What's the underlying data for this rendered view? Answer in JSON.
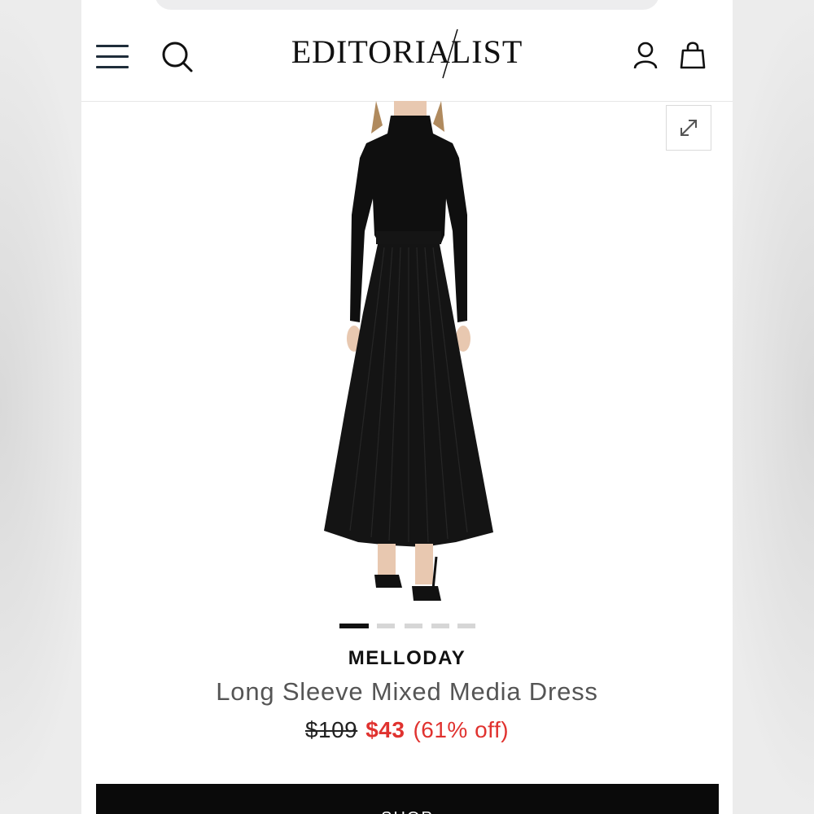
{
  "header": {
    "logo_text": "EDITORIALIST",
    "icons": [
      "menu-icon",
      "search-icon",
      "user-icon",
      "bag-icon"
    ]
  },
  "gallery": {
    "image_alt": "Woman wearing black long sleeve mock-neck top with black pleated maxi skirt and black strappy sandals",
    "expand_icon": "expand-icon",
    "slide_count": 5,
    "active_slide": 1
  },
  "product": {
    "brand": "MELLODAY",
    "title": "Long Sleeve Mixed Media Dress",
    "original_price": "$109",
    "sale_price": "$43",
    "discount": "(61% off)"
  },
  "cta": {
    "shop_label": "SHOP"
  },
  "colors": {
    "sale": "#e0322f",
    "text": "#111111",
    "button_bg": "#0a0a0a"
  }
}
